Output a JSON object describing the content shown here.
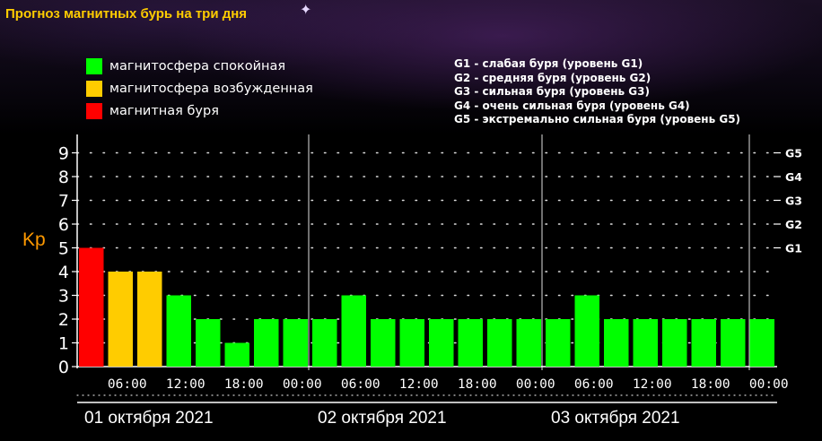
{
  "title": "Прогноз магнитных бурь на три дня",
  "legend": [
    {
      "label": "магнитосфера спокойная",
      "color": "#00ff00"
    },
    {
      "label": "магнитосфера возбужденная",
      "color": "#ffcc00"
    },
    {
      "label": "магнитная буря",
      "color": "#ff0000"
    }
  ],
  "g_scale": [
    "G1 - слабая буря (уровень G1)",
    "G2 - средняя буря (уровень G2)",
    "G3 - сильная буря (уровень G3)",
    "G4 - очень сильная буря (уровень G4)",
    "G5 - экстремально сильная буря (уровень G5)"
  ],
  "chart_data": {
    "type": "bar",
    "ylabel": "Kp",
    "ylim": [
      0,
      9
    ],
    "y_ticks": [
      "0",
      "1",
      "2",
      "3",
      "4",
      "5",
      "6",
      "7",
      "8",
      "9"
    ],
    "right_ticks": [
      {
        "label": "G1",
        "value": 5
      },
      {
        "label": "G2",
        "value": 6
      },
      {
        "label": "G3",
        "value": 7
      },
      {
        "label": "G4",
        "value": 8
      },
      {
        "label": "G5",
        "value": 9
      }
    ],
    "x_tick_labels": [
      "06:00",
      "12:00",
      "18:00",
      "00:00",
      "06:00",
      "12:00",
      "18:00",
      "00:00",
      "06:00",
      "12:00",
      "18:00",
      "00:00"
    ],
    "days": [
      "01 октября 2021",
      "02 октября 2021",
      "03 октября 2021"
    ],
    "values": [
      5,
      4,
      4,
      3,
      2,
      1,
      2,
      2,
      2,
      3,
      2,
      2,
      2,
      2,
      2,
      2,
      2,
      3,
      2,
      2,
      2,
      2,
      2,
      2
    ],
    "color_scale": {
      "green": "#00ff00",
      "yellow": "#ffcc00",
      "red": "#ff0000"
    },
    "grid": "dotted"
  }
}
